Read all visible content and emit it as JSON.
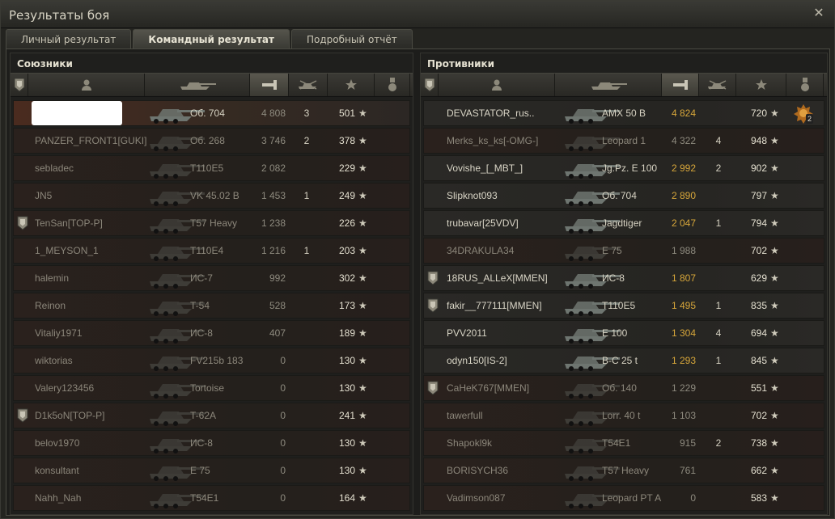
{
  "window": {
    "title": "Результаты боя",
    "close_icon": "close-icon"
  },
  "tabs": [
    {
      "label": "Личный результат",
      "active": false
    },
    {
      "label": "Командный результат",
      "active": true
    },
    {
      "label": "Подробный отчёт",
      "active": false
    }
  ],
  "allies": {
    "title": "Союзники",
    "rows": [
      {
        "name": "",
        "tank": "Об. 704",
        "damage": "4 808",
        "kills": "3",
        "xp": "501",
        "platoon": false,
        "dead": false,
        "self": true
      },
      {
        "name": "PANZER_FRONT1[GUKI]",
        "tank": "Об. 268",
        "damage": "3 746",
        "kills": "2",
        "xp": "378",
        "platoon": false,
        "dead": true
      },
      {
        "name": "sebladec",
        "tank": "T110E5",
        "damage": "2 082",
        "kills": "",
        "xp": "229",
        "platoon": false,
        "dead": true
      },
      {
        "name": "JN5",
        "tank": "VK 45.02 B",
        "damage": "1 453",
        "kills": "1",
        "xp": "249",
        "platoon": false,
        "dead": true
      },
      {
        "name": "TenSan[TOP-P]",
        "tank": "T57 Heavy",
        "damage": "1 238",
        "kills": "",
        "xp": "226",
        "platoon": true,
        "dead": true
      },
      {
        "name": "1_MEYSON_1",
        "tank": "T110E4",
        "damage": "1 216",
        "kills": "1",
        "xp": "203",
        "platoon": false,
        "dead": true
      },
      {
        "name": "halemin",
        "tank": "ИС-7",
        "damage": "992",
        "kills": "",
        "xp": "302",
        "platoon": false,
        "dead": true
      },
      {
        "name": "Reinon",
        "tank": "T-54",
        "damage": "528",
        "kills": "",
        "xp": "173",
        "platoon": false,
        "dead": true
      },
      {
        "name": "Vitaliy1971",
        "tank": "ИС-8",
        "damage": "407",
        "kills": "",
        "xp": "189",
        "platoon": false,
        "dead": true
      },
      {
        "name": "wiktorias",
        "tank": "FV215b 183",
        "damage": "0",
        "kills": "",
        "xp": "130",
        "platoon": false,
        "dead": true
      },
      {
        "name": "Valery123456",
        "tank": "Tortoise",
        "damage": "0",
        "kills": "",
        "xp": "130",
        "platoon": false,
        "dead": true
      },
      {
        "name": "D1k5oN[TOP-P]",
        "tank": "T-62A",
        "damage": "0",
        "kills": "",
        "xp": "241",
        "platoon": true,
        "dead": true
      },
      {
        "name": "belov1970",
        "tank": "ИС-8",
        "damage": "0",
        "kills": "",
        "xp": "130",
        "platoon": false,
        "dead": true
      },
      {
        "name": "konsultant",
        "tank": "E 75",
        "damage": "0",
        "kills": "",
        "xp": "130",
        "platoon": false,
        "dead": true
      },
      {
        "name": "Nahh_Nah",
        "tank": "T54E1",
        "damage": "0",
        "kills": "",
        "xp": "164",
        "platoon": false,
        "dead": true
      }
    ]
  },
  "enemies": {
    "title": "Противники",
    "rows": [
      {
        "name": "DEVASTATOR_rus..",
        "tank": "AMX 50 B",
        "damage": "4 824",
        "kills": "",
        "xp": "720",
        "platoon": false,
        "dead": false,
        "medal": "2"
      },
      {
        "name": "Merks_ks_ks[-OMG-]",
        "tank": "Leopard 1",
        "damage": "4 322",
        "kills": "4",
        "xp": "948",
        "platoon": false,
        "dead": true
      },
      {
        "name": "Vovishe_[_MBT_]",
        "tank": "Jg.Pz. E 100",
        "damage": "2 992",
        "kills": "2",
        "xp": "902",
        "platoon": false,
        "dead": false
      },
      {
        "name": "Slipknot093",
        "tank": "Об. 704",
        "damage": "2 890",
        "kills": "",
        "xp": "797",
        "platoon": false,
        "dead": false
      },
      {
        "name": "trubavar[25VDV]",
        "tank": "Jagdtiger",
        "damage": "2 047",
        "kills": "1",
        "xp": "794",
        "platoon": false,
        "dead": false
      },
      {
        "name": "34DRAKULA34",
        "tank": "E 75",
        "damage": "1 988",
        "kills": "",
        "xp": "702",
        "platoon": false,
        "dead": true
      },
      {
        "name": "18RUS_ALLeX[MMEN]",
        "tank": "ИС-8",
        "damage": "1 807",
        "kills": "",
        "xp": "629",
        "platoon": true,
        "dead": false
      },
      {
        "name": "fakir__777111[MMEN]",
        "tank": "T110E5",
        "damage": "1 495",
        "kills": "1",
        "xp": "835",
        "platoon": true,
        "dead": false
      },
      {
        "name": "PVV2011",
        "tank": "E 100",
        "damage": "1 304",
        "kills": "4",
        "xp": "694",
        "platoon": false,
        "dead": false
      },
      {
        "name": "odyn150[IS-2]",
        "tank": "В-С 25 t",
        "damage": "1 293",
        "kills": "1",
        "xp": "845",
        "platoon": false,
        "dead": false
      },
      {
        "name": "CaHeK767[MMEN]",
        "tank": "Об. 140",
        "damage": "1 229",
        "kills": "",
        "xp": "551",
        "platoon": true,
        "dead": true
      },
      {
        "name": "tawerfull",
        "tank": "Lorr. 40 t",
        "damage": "1 103",
        "kills": "",
        "xp": "702",
        "platoon": false,
        "dead": true
      },
      {
        "name": "Shapokl9k",
        "tank": "T54E1",
        "damage": "915",
        "kills": "2",
        "xp": "738",
        "platoon": false,
        "dead": true
      },
      {
        "name": "BORISYCH36",
        "tank": "T57 Heavy",
        "damage": "761",
        "kills": "",
        "xp": "662",
        "platoon": false,
        "dead": true
      },
      {
        "name": "Vadimson087",
        "tank": "Leopard PT A",
        "damage": "0",
        "kills": "",
        "xp": "583",
        "platoon": false,
        "dead": true
      }
    ]
  },
  "header_icons": [
    "platoon-icon",
    "player-icon",
    "tank-icon",
    "damage-icon",
    "kills-icon",
    "xp-star-icon",
    "medal-icon"
  ],
  "sorted_column": "damage",
  "colors": {
    "accent": "#d6a63a",
    "self_row": "#4a2b1f",
    "dead_row": "#2a211d"
  }
}
